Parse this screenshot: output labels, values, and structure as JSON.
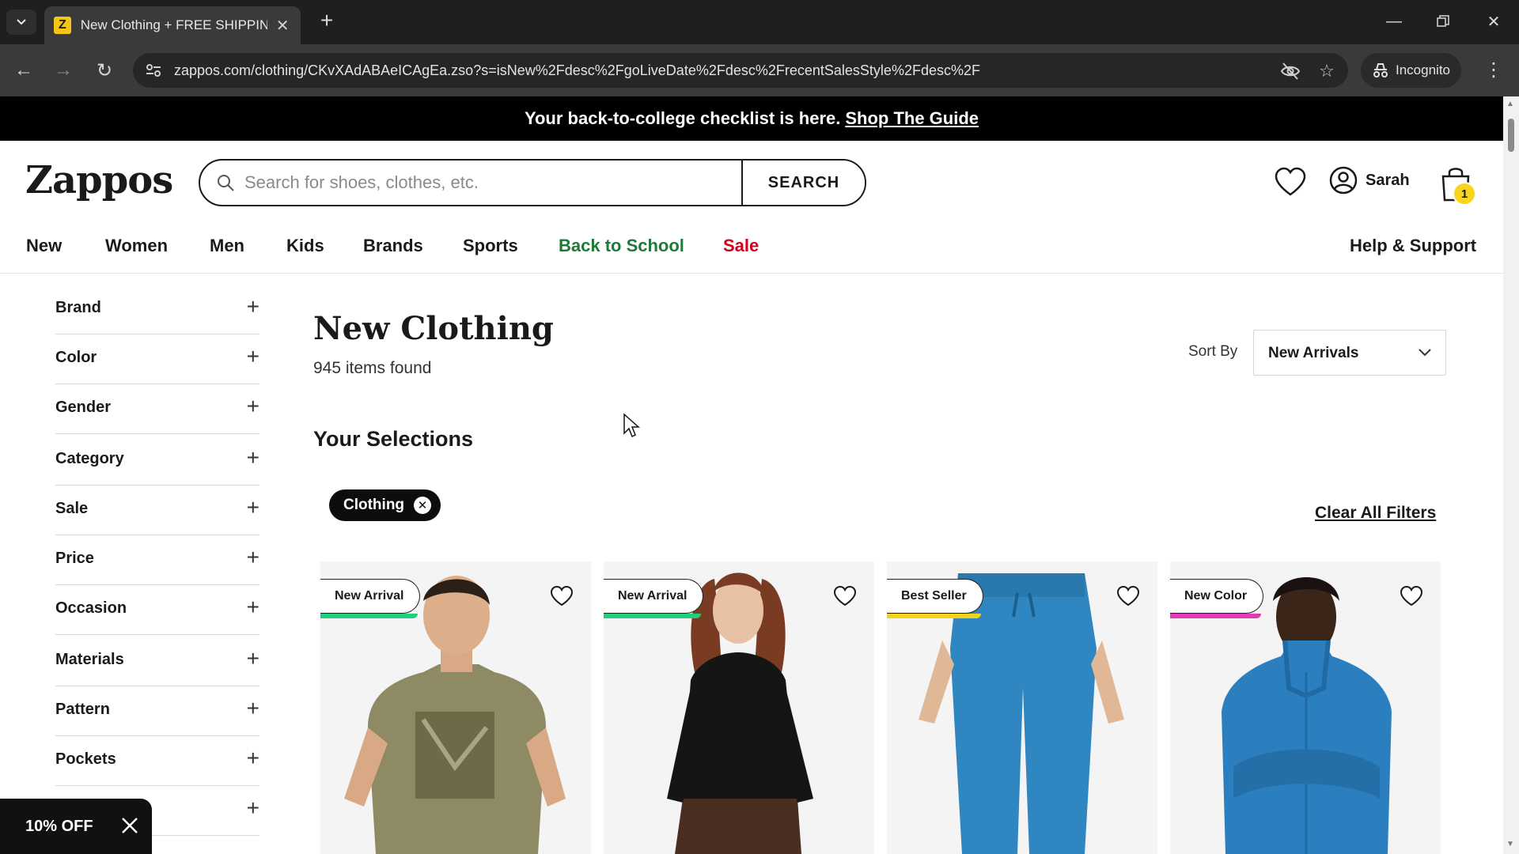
{
  "browser": {
    "tab_title": "New Clothing + FREE SHIPPING",
    "tab_favicon": "Z",
    "url": "zappos.com/clothing/CKvXAdABAeICAgEa.zso?s=isNew%2Fdesc%2FgoLiveDate%2Fdesc%2FrecentSalesStyle%2Fdesc%2F",
    "incognito_label": "Incognito"
  },
  "promo": {
    "text": "Your back-to-college checklist is here.",
    "link": "Shop The Guide"
  },
  "header": {
    "logo": "Zappos",
    "search_placeholder": "Search for shoes, clothes, etc.",
    "search_button": "SEARCH",
    "account_name": "Sarah",
    "cart_count": "1"
  },
  "nav": {
    "items": [
      "New",
      "Women",
      "Men",
      "Kids",
      "Brands",
      "Sports",
      "Back to School",
      "Sale"
    ],
    "help": "Help & Support"
  },
  "filters": [
    "Brand",
    "Color",
    "Gender",
    "Category",
    "Sale",
    "Price",
    "Occasion",
    "Materials",
    "Pattern",
    "Pockets",
    ""
  ],
  "content": {
    "title": "New Clothing",
    "count": "945 items found",
    "sort_label": "Sort By",
    "sort_value": "New Arrivals",
    "selections_title": "Your Selections",
    "chip": "Clothing",
    "clear_filters": "Clear All Filters"
  },
  "products": [
    {
      "badge": "New Arrival",
      "badge_color": "#1fcf7b",
      "image": "man-olive-graphic-tee"
    },
    {
      "badge": "New Arrival",
      "badge_color": "#1fcf7b",
      "image": "woman-black-blouse-brown-pants"
    },
    {
      "badge": "Best Seller",
      "badge_color": "#f5d31d",
      "image": "blue-joggers"
    },
    {
      "badge": "New Color",
      "badge_color": "#e43bb4",
      "image": "woman-blue-quarter-zip"
    }
  ],
  "offer": {
    "text": "10% OFF"
  },
  "colors": {
    "back_to_school": "#1f7a3a",
    "sale": "#d0021b",
    "cart_badge": "#f7d51d"
  }
}
